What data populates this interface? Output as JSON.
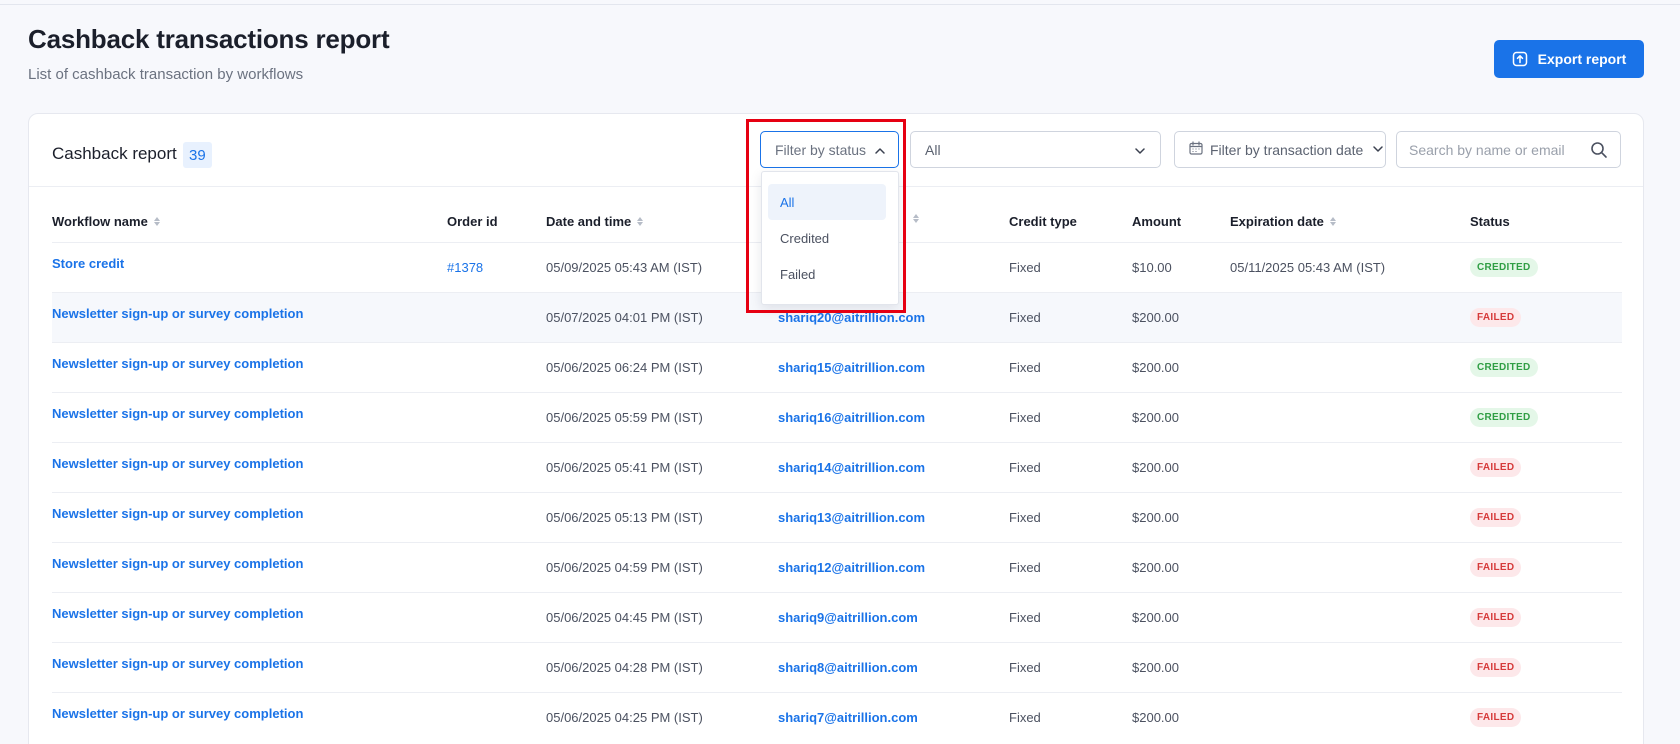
{
  "header": {
    "title": "Cashback transactions report",
    "subtitle": "List of cashback transaction by workflows",
    "export_label": "Export report"
  },
  "card": {
    "title": "Cashback report",
    "count": "39"
  },
  "filters": {
    "status_label": "Filter by status",
    "secondary_value": "All",
    "date_label": "Filter by transaction date",
    "search_placeholder": "Search by name or email"
  },
  "status_dropdown": {
    "options": [
      "All",
      "Credited",
      "Failed"
    ],
    "selected": "All"
  },
  "table": {
    "columns": {
      "workflow": "Workflow name",
      "order": "Order id",
      "datetime": "Date and time",
      "email": "",
      "credit_type": "Credit type",
      "amount": "Amount",
      "expiration": "Expiration date",
      "status": "Status"
    },
    "rows": [
      {
        "workflow": "Store credit",
        "order": "#1378",
        "datetime": "05/09/2025 05:43 AM (IST)",
        "email": "om",
        "credit_type": "Fixed",
        "amount": "$10.00",
        "expiration": "05/11/2025 05:43 AM (IST)",
        "status": "CREDITED"
      },
      {
        "workflow": "Newsletter sign-up or survey completion",
        "order": "",
        "datetime": "05/07/2025 04:01 PM (IST)",
        "email": "shariq20@aitrillion.com",
        "credit_type": "Fixed",
        "amount": "$200.00",
        "expiration": "",
        "status": "FAILED"
      },
      {
        "workflow": "Newsletter sign-up or survey completion",
        "order": "",
        "datetime": "05/06/2025 06:24 PM (IST)",
        "email": "shariq15@aitrillion.com",
        "credit_type": "Fixed",
        "amount": "$200.00",
        "expiration": "",
        "status": "CREDITED"
      },
      {
        "workflow": "Newsletter sign-up or survey completion",
        "order": "",
        "datetime": "05/06/2025 05:59 PM (IST)",
        "email": "shariq16@aitrillion.com",
        "credit_type": "Fixed",
        "amount": "$200.00",
        "expiration": "",
        "status": "CREDITED"
      },
      {
        "workflow": "Newsletter sign-up or survey completion",
        "order": "",
        "datetime": "05/06/2025 05:41 PM (IST)",
        "email": "shariq14@aitrillion.com",
        "credit_type": "Fixed",
        "amount": "$200.00",
        "expiration": "",
        "status": "FAILED"
      },
      {
        "workflow": "Newsletter sign-up or survey completion",
        "order": "",
        "datetime": "05/06/2025 05:13 PM (IST)",
        "email": "shariq13@aitrillion.com",
        "credit_type": "Fixed",
        "amount": "$200.00",
        "expiration": "",
        "status": "FAILED"
      },
      {
        "workflow": "Newsletter sign-up or survey completion",
        "order": "",
        "datetime": "05/06/2025 04:59 PM (IST)",
        "email": "shariq12@aitrillion.com",
        "credit_type": "Fixed",
        "amount": "$200.00",
        "expiration": "",
        "status": "FAILED"
      },
      {
        "workflow": "Newsletter sign-up or survey completion",
        "order": "",
        "datetime": "05/06/2025 04:45 PM (IST)",
        "email": "shariq9@aitrillion.com",
        "credit_type": "Fixed",
        "amount": "$200.00",
        "expiration": "",
        "status": "FAILED"
      },
      {
        "workflow": "Newsletter sign-up or survey completion",
        "order": "",
        "datetime": "05/06/2025 04:28 PM (IST)",
        "email": "shariq8@aitrillion.com",
        "credit_type": "Fixed",
        "amount": "$200.00",
        "expiration": "",
        "status": "FAILED"
      },
      {
        "workflow": "Newsletter sign-up or survey completion",
        "order": "",
        "datetime": "05/06/2025 04:25 PM (IST)",
        "email": "shariq7@aitrillion.com",
        "credit_type": "Fixed",
        "amount": "$200.00",
        "expiration": "",
        "status": "FAILED"
      }
    ]
  },
  "colors": {
    "accent": "#1a73e8",
    "highlight": "#e60012",
    "credited_text": "#2f9e44",
    "failed_text": "#d63a3a"
  }
}
